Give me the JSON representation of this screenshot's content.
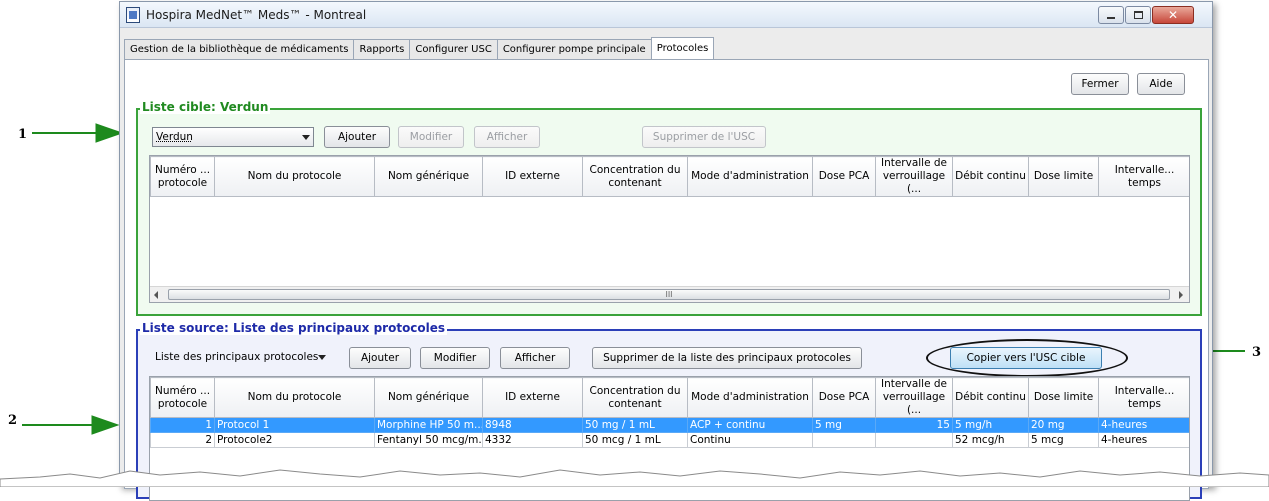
{
  "window": {
    "title": "Hospira MedNet™ Meds™ - Montreal"
  },
  "tabs": [
    {
      "label": "Gestion de la bibliothèque de médicaments",
      "active": false
    },
    {
      "label": "Rapports",
      "active": false
    },
    {
      "label": "Configurer USC",
      "active": false
    },
    {
      "label": "Configurer pompe principale",
      "active": false
    },
    {
      "label": "Protocoles",
      "active": true
    }
  ],
  "toolbar": {
    "close_label": "Fermer",
    "help_label": "Aide"
  },
  "target": {
    "title": "Liste cible: Verdun",
    "select_value": "Verdun",
    "add_label": "Ajouter",
    "modify_label": "Modifier",
    "view_label": "Afficher",
    "remove_label": "Supprimer de l'USC",
    "scroll_marker": "III"
  },
  "columns": [
    "Numéro ... protocole",
    "Nom du protocole",
    "Nom générique",
    "ID externe",
    "Concentration du contenant",
    "Mode d'administration",
    "Dose PCA",
    "Intervalle de verrouillage (...",
    "Débit continu",
    "Dose limite",
    "Intervalle... temps"
  ],
  "source": {
    "title": "Liste source: Liste des principaux protocoles",
    "select_value": "Liste des principaux protocoles",
    "add_label": "Ajouter",
    "modify_label": "Modifier",
    "view_label": "Afficher",
    "remove_label": "Supprimer de la liste des principaux protocoles",
    "copy_label": "Copier vers l'USC cible",
    "rows": [
      {
        "num": "1",
        "name": "Protocol 1",
        "generic": "Morphine HP  50 m...",
        "ext": "8948",
        "conc": "50 mg / 1 mL",
        "mode": "ACP + continu",
        "pca": "5 mg",
        "lock": "15",
        "rate": "5 mg/h",
        "limit": "20 mg",
        "interval": "4-heures",
        "selected": true
      },
      {
        "num": "2",
        "name": "Protocole2",
        "generic": "Fentanyl 50 mcg/m...",
        "ext": "4332",
        "conc": "50 mcg / 1 mL",
        "mode": "Continu",
        "pca": "",
        "lock": "",
        "rate": "52 mcg/h",
        "limit": "5 mcg",
        "interval": "4-heures",
        "selected": false
      }
    ]
  },
  "callouts": {
    "one": "1",
    "two": "2",
    "three": "3"
  },
  "colors": {
    "green": "#3aa33a",
    "blue": "#2b3fb8",
    "selection": "#3399ff",
    "arrow": "#1d8a1d"
  }
}
